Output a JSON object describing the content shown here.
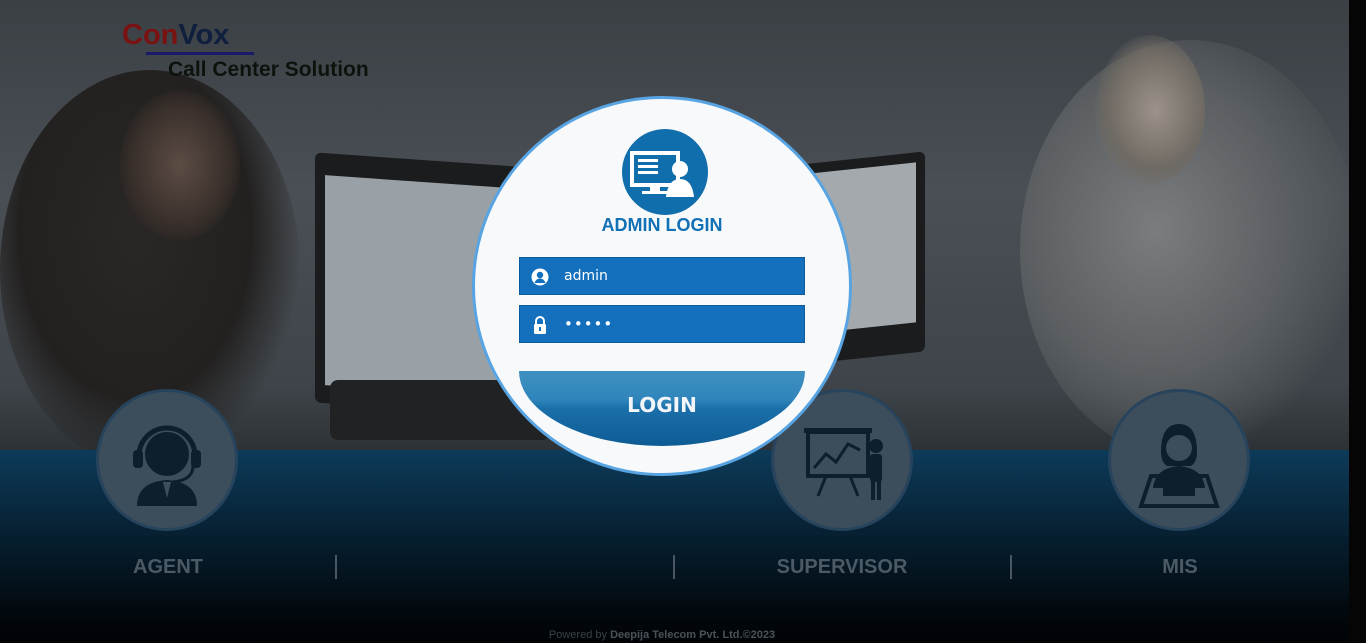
{
  "brand": {
    "logo_con": "Con",
    "logo_vox": "Vox",
    "tagline": "Call Center Solution"
  },
  "login": {
    "title": "ADMIN LOGIN",
    "username_value": "admin",
    "password_value": "•••••",
    "button_label": "LOGIN"
  },
  "roles": [
    {
      "label": "AGENT",
      "icon": "agent-headset-icon"
    },
    {
      "label": "SUPERVISOR",
      "icon": "presentation-chart-icon"
    },
    {
      "label": "MIS",
      "icon": "operator-laptop-icon"
    }
  ],
  "footer": {
    "prefix": "Powered by ",
    "company": "Deepija Telecom Pvt. Ltd.©2023"
  },
  "colors": {
    "accent": "#1270b4",
    "field_bg": "#1470bd",
    "circle_border": "#58a4e2"
  }
}
